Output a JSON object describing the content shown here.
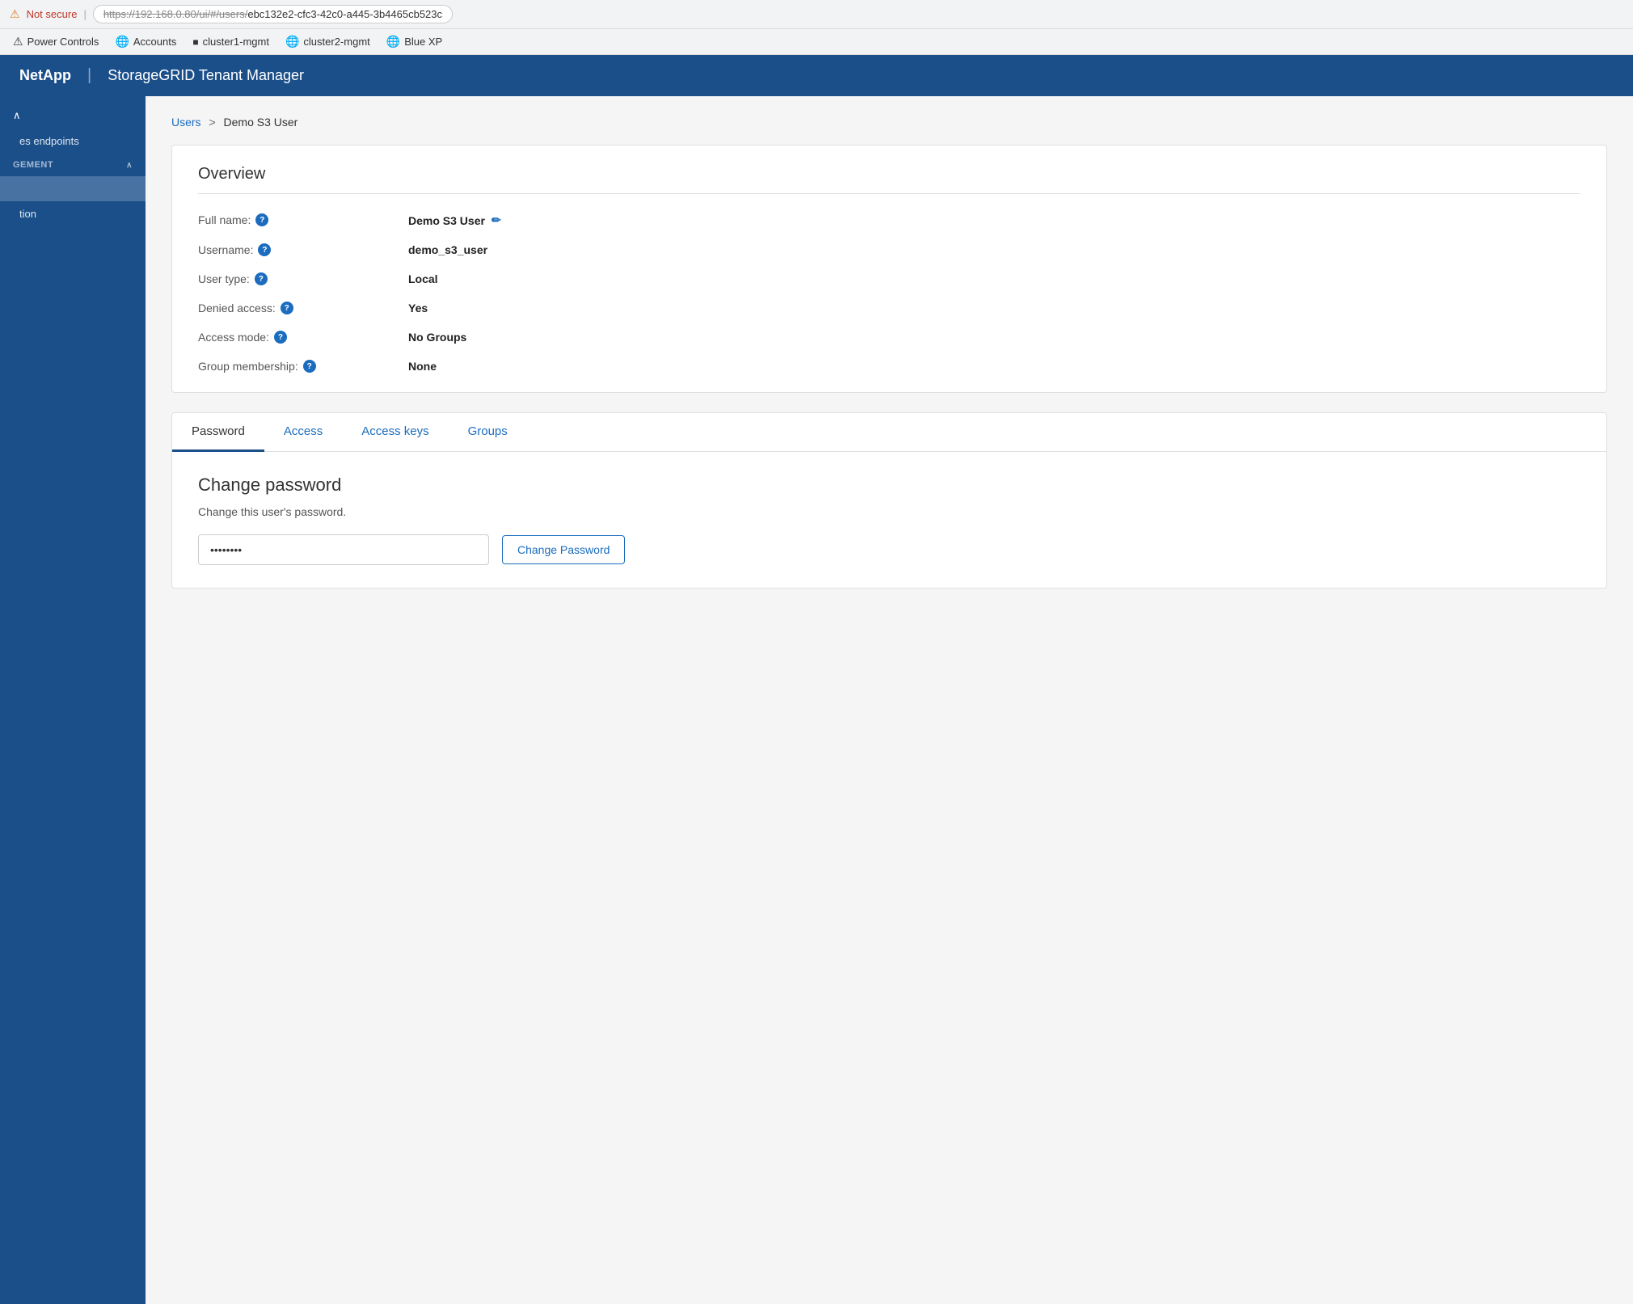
{
  "browser": {
    "not_secure_label": "Not secure",
    "url": "https://192.168.0.80/ui/#/users/ebc132e2-cfc3-42c0-a445-3b4465cb523c"
  },
  "bookmarks": [
    {
      "id": "power-controls",
      "label": "Power Controls",
      "icon": "⚠"
    },
    {
      "id": "accounts",
      "label": "Accounts",
      "icon": "🌐"
    },
    {
      "id": "cluster1-mgmt",
      "label": "cluster1-mgmt",
      "icon": "▪"
    },
    {
      "id": "cluster2-mgmt",
      "label": "cluster2-mgmt",
      "icon": "🌐"
    },
    {
      "id": "blue-xp",
      "label": "Blue XP",
      "icon": "🌐"
    }
  ],
  "header": {
    "logo": "NetApp",
    "divider": "|",
    "title": "StorageGRID Tenant Manager"
  },
  "sidebar": {
    "sections": [
      {
        "id": "collapse-toggle",
        "label": "^",
        "type": "toggle"
      },
      {
        "id": "es-endpoints",
        "label": "es endpoints",
        "type": "item"
      },
      {
        "id": "management",
        "label": "GEMENT",
        "type": "section-label",
        "expanded": true
      },
      {
        "id": "management-sub1",
        "label": "",
        "type": "item",
        "active": true
      },
      {
        "id": "tion",
        "label": "tion",
        "type": "item"
      }
    ]
  },
  "breadcrumb": {
    "parent_label": "Users",
    "separator": ">",
    "current": "Demo S3 User"
  },
  "overview": {
    "title": "Overview",
    "fields": [
      {
        "id": "full-name",
        "label": "Full name:",
        "value": "Demo S3 User",
        "editable": true
      },
      {
        "id": "username",
        "label": "Username:",
        "value": "demo_s3_user",
        "editable": false
      },
      {
        "id": "user-type",
        "label": "User type:",
        "value": "Local",
        "editable": false
      },
      {
        "id": "denied-access",
        "label": "Denied access:",
        "value": "Yes",
        "editable": false
      },
      {
        "id": "access-mode",
        "label": "Access mode:",
        "value": "No Groups",
        "editable": false
      },
      {
        "id": "group-membership",
        "label": "Group membership:",
        "value": "None",
        "editable": false
      }
    ]
  },
  "tabs": [
    {
      "id": "password",
      "label": "Password",
      "active": true
    },
    {
      "id": "access",
      "label": "Access",
      "active": false
    },
    {
      "id": "access-keys",
      "label": "Access keys",
      "active": false
    },
    {
      "id": "groups",
      "label": "Groups",
      "active": false
    }
  ],
  "password_tab": {
    "title": "Change password",
    "description": "Change this user's password.",
    "password_placeholder": "••••••••",
    "change_button_label": "Change Password"
  },
  "colors": {
    "primary_blue": "#1b4f8a",
    "link_blue": "#1b6cbf"
  }
}
